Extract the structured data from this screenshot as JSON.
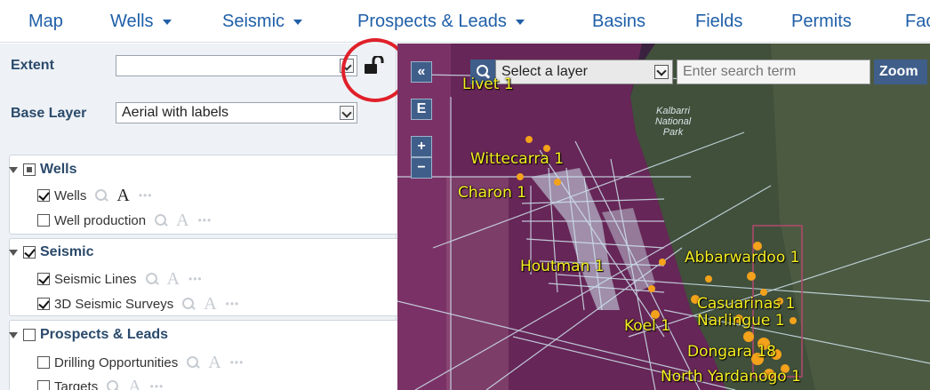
{
  "nav": {
    "items": [
      {
        "label": "Map",
        "dropdown": false
      },
      {
        "label": "Wells",
        "dropdown": true
      },
      {
        "label": "Seismic",
        "dropdown": true
      },
      {
        "label": "Prospects & Leads",
        "dropdown": true
      },
      {
        "label": "Basins",
        "dropdown": false
      },
      {
        "label": "Fields",
        "dropdown": false
      },
      {
        "label": "Permits",
        "dropdown": false
      },
      {
        "label": "Fac",
        "dropdown": false
      }
    ]
  },
  "sidebar": {
    "extent_label": "Extent",
    "extent_value": "",
    "base_layer_label": "Base Layer",
    "base_layer_value": "Aerial with labels",
    "groups": [
      {
        "name": "Wells",
        "layers": [
          "Wells",
          "Well production"
        ]
      },
      {
        "name": "Seismic",
        "layers": [
          "Seismic Lines",
          "3D Seismic Surveys"
        ]
      },
      {
        "name": "Prospects & Leads",
        "layers": [
          "Drilling Opportunities",
          "Targets"
        ]
      }
    ]
  },
  "map": {
    "collapse_label": "«",
    "extent_button_label": "E",
    "zoom_in_label": "+",
    "zoom_out_label": "−",
    "search": {
      "layer_select_value": "Select a layer",
      "search_placeholder": "Enter search term",
      "zoom_label": "Zoom"
    },
    "park_label": "Kalbarri National Park",
    "labels": [
      "Livet 1",
      "Wittecarra 1",
      "Charon 1",
      "Houtman 1",
      "Abbarwardoo 1",
      "Casuarinas 1",
      "Narlingue 1",
      "Koel 1",
      "Dongara 18",
      "North Yardanogo 1"
    ]
  },
  "icons": {
    "lock": "unlocked-padlock-icon",
    "search": "search-icon",
    "zoom_tool": "magnifier-icon",
    "label_tool": "text-label-icon",
    "more": "ellipsis-icon"
  },
  "colors": {
    "nav_text": "#1f5fa8",
    "highlight_circle": "#e0202a",
    "map_label": "#f6ee21",
    "map_button": "#3f5e8a",
    "permit_overlay": "#8a2b6a",
    "seismic_lines": "#cfe3ee",
    "well_dots": "#f4a21b"
  }
}
